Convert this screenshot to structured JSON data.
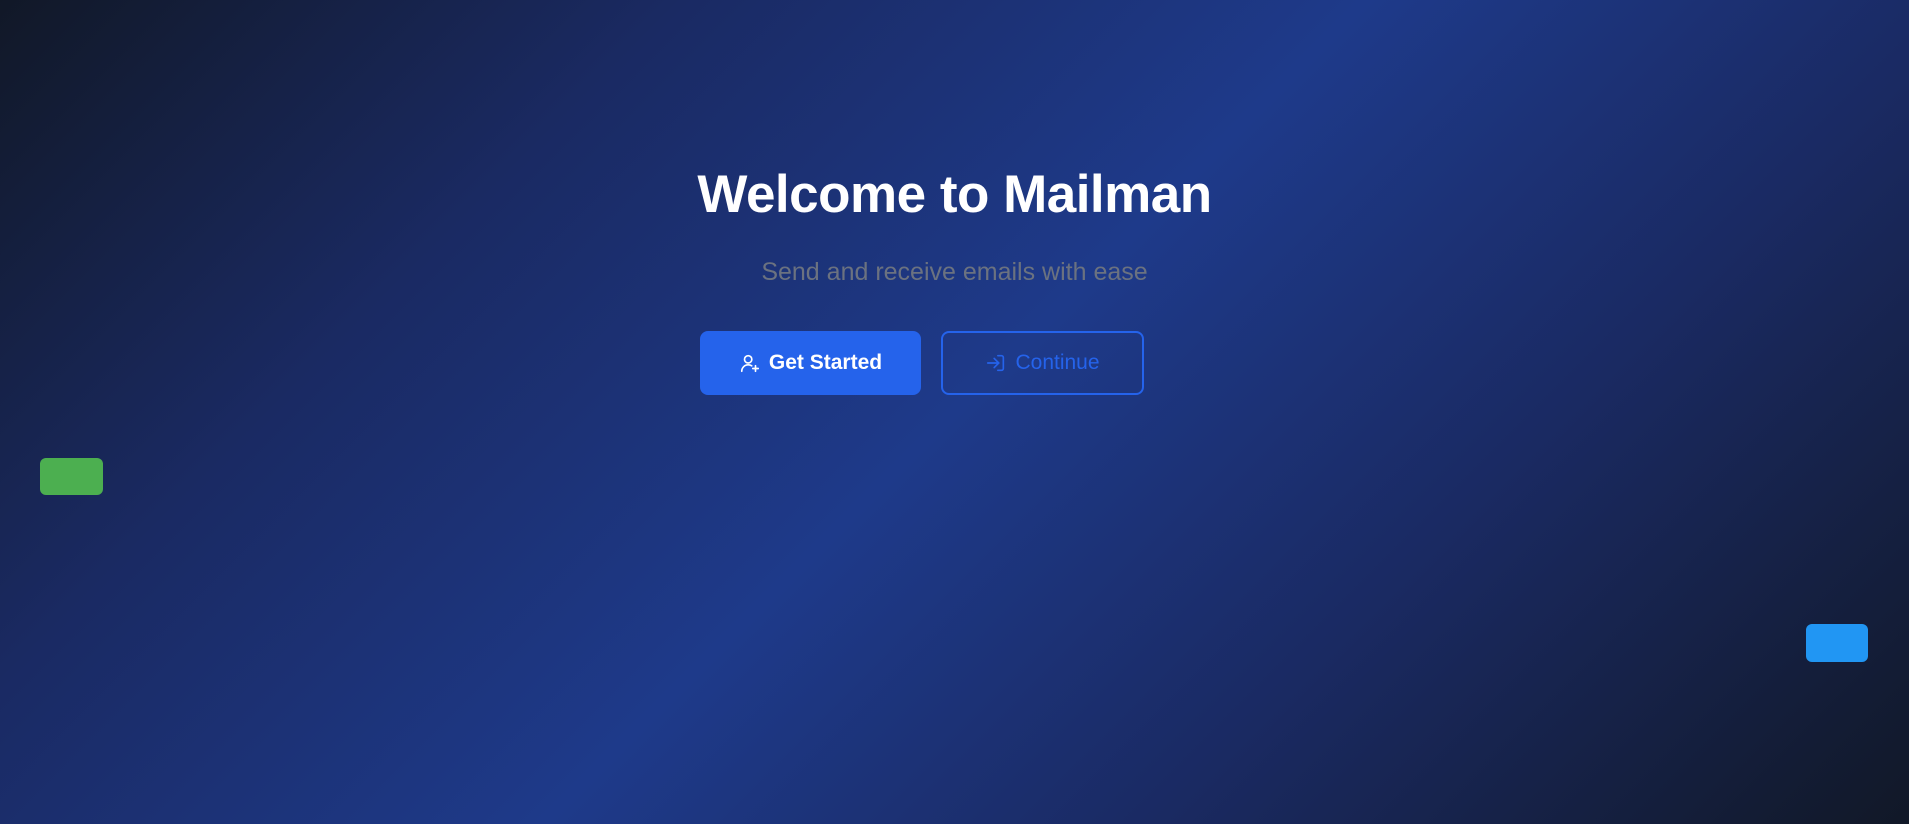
{
  "hero": {
    "title": "Welcome to Mailman",
    "subtitle": "Send and receive emails with ease"
  },
  "actions": {
    "get_started": {
      "label": "Get Started",
      "icon": "user-plus-icon"
    },
    "continue": {
      "label": "Continue",
      "icon": "log-in-icon"
    }
  },
  "colors": {
    "primary": "#2563eb",
    "background_dark": "#111827",
    "background_mid": "#1e3a8a",
    "subtitle": "#6b7280",
    "accent_green": "#4caf50",
    "accent_blue": "#2196f3"
  }
}
